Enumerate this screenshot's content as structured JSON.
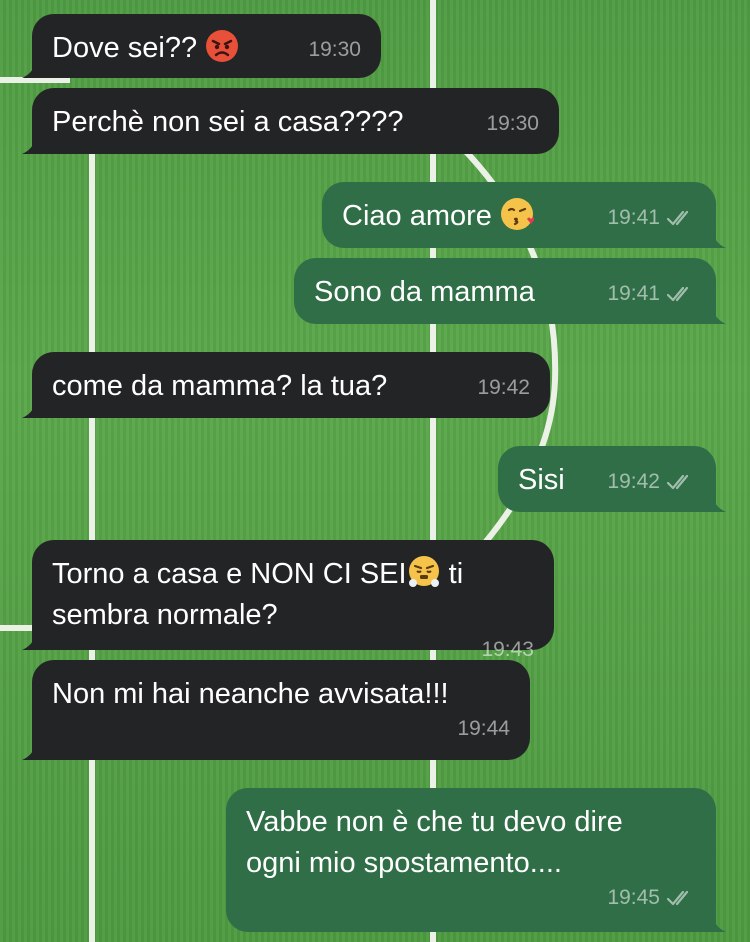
{
  "messages": [
    {
      "direction": "incoming",
      "text": "Dove sei?? ",
      "emoji": "angry-face-icon",
      "time": "19:30"
    },
    {
      "direction": "incoming",
      "text": "Perchè non sei a casa????",
      "time": "19:30"
    },
    {
      "direction": "outgoing",
      "text": "Ciao amore ",
      "emoji": "kiss-face-icon",
      "time": "19:41",
      "read": "double-tick-icon"
    },
    {
      "direction": "outgoing",
      "text": "Sono da mamma",
      "time": "19:41",
      "read": "double-tick-icon"
    },
    {
      "direction": "incoming",
      "text": "come da mamma? la tua?",
      "time": "19:42"
    },
    {
      "direction": "outgoing",
      "text": "Sisi",
      "time": "19:42",
      "read": "double-tick-icon"
    },
    {
      "direction": "incoming",
      "text_a": "Torno a casa e NON CI SEI",
      "emoji": "huffing-face-icon",
      "text_b": " ti\nsembra normale?",
      "time": "19:43"
    },
    {
      "direction": "incoming",
      "text": "Non mi hai neanche avvisata!!!",
      "time": "19:44"
    },
    {
      "direction": "outgoing",
      "text": "Vabbe non è che tu devo dire\nogni mio spostamento....",
      "time": "19:45",
      "read": "double-tick-icon"
    }
  ],
  "colors": {
    "incoming": "#232425",
    "outgoing": "#2f6e47",
    "background": "#55a246"
  }
}
